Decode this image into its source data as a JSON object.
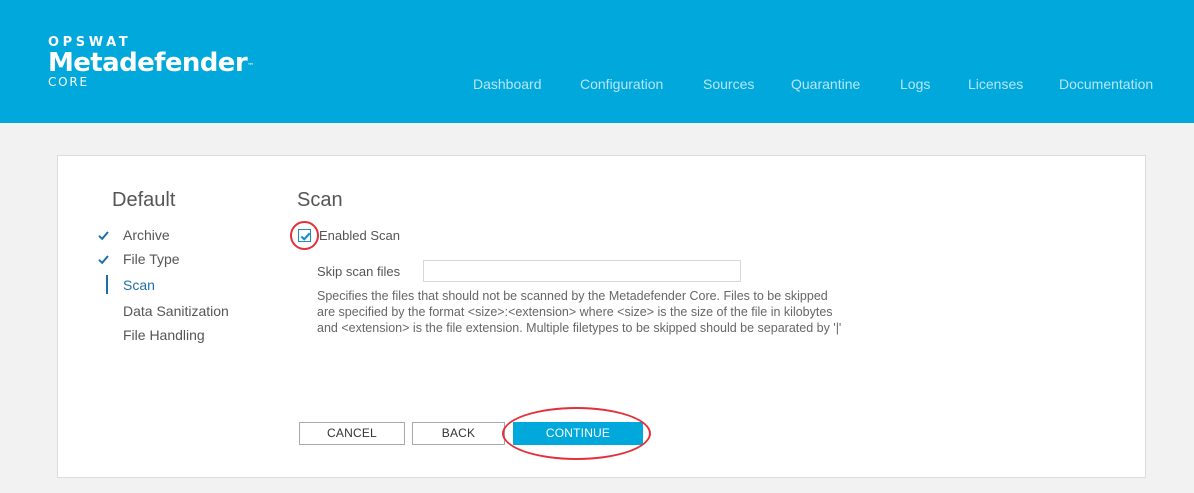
{
  "brand": {
    "company": "OPSWAT",
    "product": "Metadefender",
    "trademark": "™",
    "edition": "CORE"
  },
  "nav": [
    {
      "label": "Dashboard"
    },
    {
      "label": "Configuration"
    },
    {
      "label": "Sources"
    },
    {
      "label": "Quarantine"
    },
    {
      "label": "Logs"
    },
    {
      "label": "Licenses"
    },
    {
      "label": "Documentation"
    }
  ],
  "sidebar": {
    "title": "Default",
    "items": [
      {
        "label": "Archive",
        "state": "done"
      },
      {
        "label": "File Type",
        "state": "done"
      },
      {
        "label": "Scan",
        "state": "active"
      },
      {
        "label": "Data Sanitization",
        "state": "pending"
      },
      {
        "label": "File Handling",
        "state": "pending"
      }
    ]
  },
  "main": {
    "title": "Scan",
    "enabled_scan": {
      "label": "Enabled Scan",
      "checked": true
    },
    "skip_scan": {
      "label": "Skip scan files",
      "value": "",
      "help": "Specifies the files that should not be scanned by the Metadefender Core. Files to be skipped are specified by the format <size>:<extension> where <size> is the size of the file in kilobytes and <extension> is the file extension. Multiple filetypes to be skipped should be separated by '|'"
    }
  },
  "buttons": {
    "cancel": "CANCEL",
    "back": "BACK",
    "continue": "CONTINUE"
  },
  "colors": {
    "accent": "#00a8db",
    "active_link": "#1f6fa7",
    "annotation": "#e3313a"
  },
  "icons": {
    "check": "checkmark-icon"
  }
}
